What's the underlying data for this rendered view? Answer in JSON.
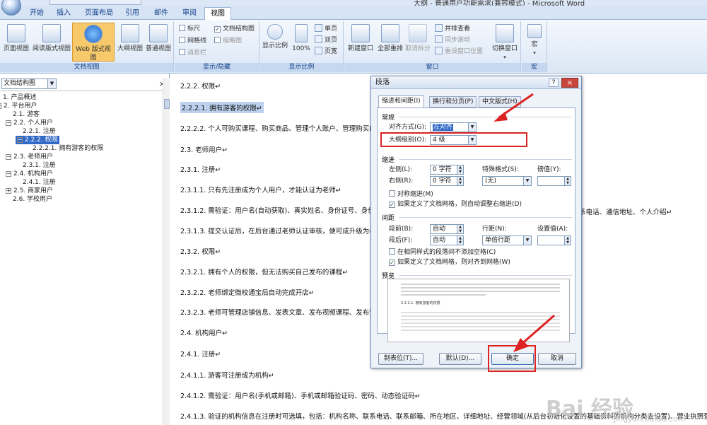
{
  "app": {
    "title_fragment": "大纲 - 普通用户功能需求(兼容模式) - Microsoft Word"
  },
  "ribbon": {
    "tabs": [
      "开始",
      "插入",
      "页面布局",
      "引用",
      "邮件",
      "审阅",
      "视图"
    ],
    "active_tab": "视图",
    "groups": {
      "doc_views": {
        "label": "文档视图",
        "buttons": [
          "页面视图",
          "阅读版式视图",
          "Web 版式视图",
          "大纲视图",
          "普通视图"
        ],
        "selected": "Web 版式视图"
      },
      "show_hide": {
        "label": "显示/隐藏",
        "items": [
          {
            "label": "标尺",
            "checked": false,
            "disabled": false
          },
          {
            "label": "文档结构图",
            "checked": true,
            "disabled": false
          },
          {
            "label": "网格线",
            "checked": false,
            "disabled": false
          },
          {
            "label": "缩略图",
            "checked": false,
            "disabled": true
          },
          {
            "label": "消息栏",
            "checked": false,
            "disabled": true
          }
        ]
      },
      "zoom": {
        "label": "显示比例",
        "zoom_label": "显示比例",
        "percent": "100%",
        "single": "单页",
        "double": "双页",
        "width": "页宽"
      },
      "window": {
        "label": "窗口",
        "new_window": "新建窗口",
        "arrange_all": "全部重排",
        "split": "取消拆分",
        "side_by_side": "并排查看",
        "sync_scroll": "同步滚动",
        "reset_position": "重设窗口位置",
        "switch_window": "切换窗口"
      },
      "macro": {
        "label": "宏",
        "button": "宏"
      }
    }
  },
  "nav_pane": {
    "selector": "文档结构图",
    "close": "×",
    "items": [
      {
        "text": "1. 产品概述",
        "level": 0,
        "expander": ""
      },
      {
        "text": "2. 平台用户",
        "level": 0,
        "expander": "−"
      },
      {
        "text": "2.1. 游客",
        "level": 1,
        "expander": ""
      },
      {
        "text": "2.2. 个人用户",
        "level": 1,
        "expander": "−"
      },
      {
        "text": "2.2.1. 注册",
        "level": 2,
        "expander": ""
      },
      {
        "text": "2.2.2. 权限",
        "level": 2,
        "expander": "−",
        "selected": true
      },
      {
        "text": "2.2.2.1. 拥有游客的权限",
        "level": 3,
        "expander": ""
      },
      {
        "text": "2.3. 老师用户",
        "level": 1,
        "expander": "−"
      },
      {
        "text": "2.3.1. 注册",
        "level": 2,
        "expander": ""
      },
      {
        "text": "2.4. 机构用户",
        "level": 1,
        "expander": "−"
      },
      {
        "text": "2.4.1. 注册",
        "level": 2,
        "expander": ""
      },
      {
        "text": "2.5. 商家用户",
        "level": 1,
        "expander": "+"
      },
      {
        "text": "2.6. 学校用户",
        "level": 1,
        "expander": ""
      }
    ]
  },
  "document": {
    "lines": [
      {
        "text": "2.2.2. 权限↵"
      },
      {
        "text": "2.2.2.1. 拥有游客的权限↵",
        "highlight": true
      },
      {
        "text": "2.2.2.2. 个人可购买课程、购买商品、管理个人账户、管理购买的课"
      },
      {
        "text": "2.3. 老师用户↵"
      },
      {
        "text": "2.3.1. 注册↵"
      },
      {
        "text": "2.3.1.1. 只有先注册成为个人用户，才能认证为老师↵"
      },
      {
        "text": "2.3.1.2. 需验证：用户名(自动获取)、真实姓名、身份证号、身份证"
      },
      {
        "text": "2.3.1.3. 提交认证后，在后台通过老师认证审核，便可成升级为老师"
      },
      {
        "text": "2.3.2. 权限↵"
      },
      {
        "text": "2.3.2.1. 拥有个人的权限，但无法购买自己发布的课程↵"
      },
      {
        "text": "2.3.2.2. 老师绑定微校通宝后自动完成开店↵"
      },
      {
        "text": "2.3.2.3. 老师可管理店铺信息、发表文章、发布视频课程、发布课程"
      },
      {
        "text": "2.4. 机构用户↵"
      },
      {
        "text": "2.4.1. 注册↵"
      },
      {
        "text": "2.4.1.1. 游客可注册成为机构↵"
      },
      {
        "text": "2.4.1.2. 需验证：用户名(手机或邮箱)、手机或邮箱验证码、密码、动态验证码↵"
      },
      {
        "text": "2.4.1.3. 验证的机构信息在注册时可选填，包括：机构名称、联系电话、联系邮箱、所在地区、详细地址、经营领域(从后台初始化设置的基础资料的机构分类去设置)、营业执照登记号、营业执照"
      }
    ],
    "overflow_text": "系电话、通信地址、个人介绍↵"
  },
  "dialog": {
    "title": "段落",
    "help": "?",
    "close": "×",
    "tabs": [
      "缩进和间距(I)",
      "换行和分页(P)",
      "中文版式(H)"
    ],
    "active_tab": "缩进和间距(I)",
    "general": {
      "section": "常规",
      "alignment_label": "对齐方式(G):",
      "alignment_value": "左对齐",
      "outline_label": "大纲级别(O):",
      "outline_value": "4 级"
    },
    "indent": {
      "section": "缩进",
      "left_label": "左侧(L):",
      "left_value": "0 字符",
      "right_label": "右侧(R):",
      "right_value": "0 字符",
      "special_label": "特殊格式(S):",
      "special_value": "(无)",
      "by_label": "磅值(Y):",
      "by_value": "",
      "mirror_label": "对称缩进(M)",
      "mirror_checked": false,
      "auto_adjust_label": "如果定义了文档网格，则自动调整右缩进(D)",
      "auto_adjust_checked": true
    },
    "spacing": {
      "section": "间距",
      "before_label": "段前(B):",
      "before_value": "自动",
      "after_label": "段后(F):",
      "after_value": "自动",
      "line_label": "行距(N):",
      "line_value": "单倍行距",
      "at_label": "设置值(A):",
      "at_value": "",
      "no_space_label": "在相同样式的段落间不添加空格(C)",
      "no_space_checked": false,
      "snap_grid_label": "如果定义了文档网格，则对齐到网格(W)",
      "snap_grid_checked": true
    },
    "preview": {
      "section": "预览",
      "sample": "2.2.2.1. 拥有游客的权限"
    },
    "buttons": {
      "tabs": "制表位(T)...",
      "default": "默认(D)...",
      "ok": "确定",
      "cancel": "取消"
    }
  },
  "watermark": {
    "brand": "Bai 经验",
    "url": "jingyan.baidu.com"
  },
  "colors": {
    "ribbon_blue": "#15428b",
    "selection": "#3169c6",
    "annotation_red": "#d22222"
  }
}
